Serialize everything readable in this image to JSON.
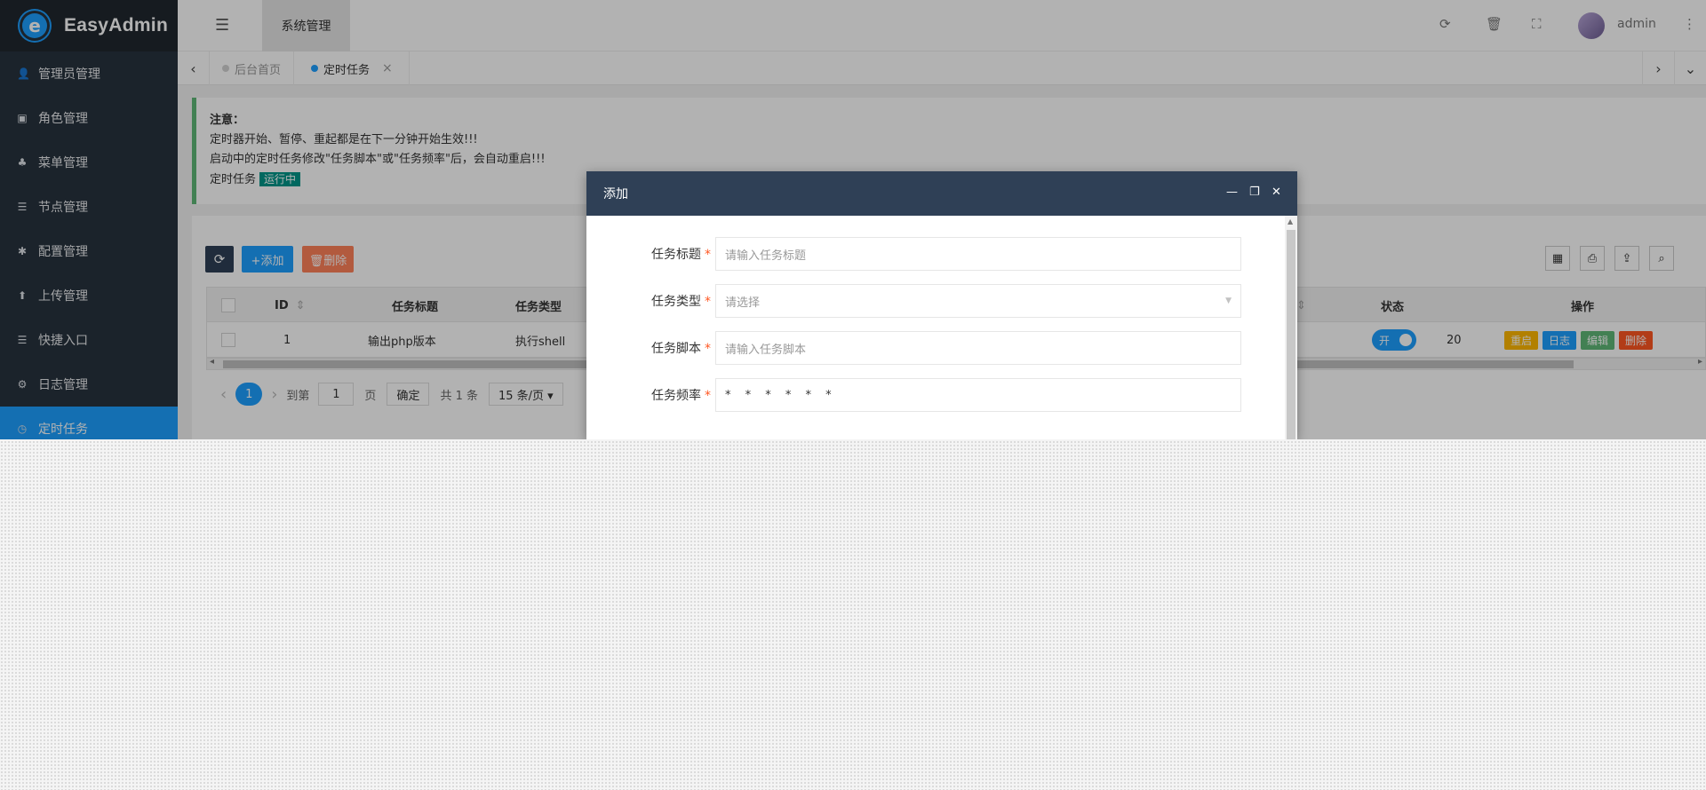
{
  "app": {
    "logo_letter": "e",
    "name": "EasyAdmin"
  },
  "sidebar": {
    "items": [
      {
        "icon": "user-icon",
        "glyph": "👤",
        "label": "管理员管理"
      },
      {
        "icon": "role-icon",
        "glyph": "▣",
        "label": "角色管理"
      },
      {
        "icon": "tree-icon",
        "glyph": "♣",
        "label": "菜单管理"
      },
      {
        "icon": "list-icon",
        "glyph": "☰",
        "label": "节点管理"
      },
      {
        "icon": "asterisk-icon",
        "glyph": "✱",
        "label": "配置管理"
      },
      {
        "icon": "upload-icon",
        "glyph": "⬆",
        "label": "上传管理"
      },
      {
        "icon": "list-icon",
        "glyph": "☰",
        "label": "快捷入口"
      },
      {
        "icon": "gear-icon",
        "glyph": "⚙",
        "label": "日志管理"
      },
      {
        "icon": "clock-icon",
        "glyph": "◷",
        "label": "定时任务"
      }
    ],
    "active_index": 8
  },
  "header": {
    "menu_toggle_glyph": "☰",
    "top_tab": "系统管理",
    "icons": {
      "refresh": "⟳",
      "trash": "🗑",
      "fullscreen": "⛶",
      "more": "⋮"
    },
    "user": "admin"
  },
  "tabs": {
    "prev_glyph": "‹",
    "next_glyph": "›",
    "dropdown_glyph": "⌄",
    "items": [
      {
        "label": "后台首页",
        "dot_color": "#d2d2d2"
      },
      {
        "label": "定时任务",
        "dot_color": "#1e9fff",
        "close": "×"
      }
    ]
  },
  "notice": {
    "title": "注意：",
    "lines": [
      "定时器开始、暂停、重起都是在下一分钟开始生效!!!",
      "启动中的定时任务修改\"任务脚本\"或\"任务频率\"后，会自动重启!!!"
    ],
    "status_label": "定时任务",
    "status_badge": "运行中"
  },
  "toolbar": {
    "refresh_glyph": "⟳",
    "add_label": "+添加",
    "delete_label": "🗑删除",
    "tools": {
      "columns": "▦",
      "print": "⎙",
      "export": "⇪",
      "search": "⌕"
    }
  },
  "table": {
    "headers": {
      "id": "ID",
      "title": "任务标题",
      "type": "任务类型",
      "status": "状态",
      "actions": "操作",
      "sort_glyph": "⇕"
    },
    "rows": [
      {
        "id": "1",
        "title": "输出php版本",
        "type": "执行shell",
        "switch_label": "开",
        "partial": "20",
        "actions": [
          "重启",
          "日志",
          "编辑",
          "删除"
        ]
      }
    ],
    "action_colors": [
      "#ffb800",
      "#1e9fff",
      "#5fb878",
      "#ff5722"
    ],
    "scroll_left": "◂",
    "scroll_right": "▸"
  },
  "pager": {
    "prev": "‹",
    "current": "1",
    "next": "›",
    "goto": "到第",
    "page_input": "1",
    "page_unit": "页",
    "confirm": "确定",
    "total": "共 1 条",
    "per_page": "15 条/页 ▾"
  },
  "modal": {
    "title": "添加",
    "controls": {
      "min": "—",
      "max": "❐",
      "close": "✕"
    },
    "fields": [
      {
        "label": "任务标题",
        "required": "*",
        "placeholder": "请输入任务标题",
        "value": ""
      },
      {
        "label": "任务类型",
        "required": "*",
        "placeholder": "请选择",
        "value": "",
        "arrow": "▼"
      },
      {
        "label": "任务脚本",
        "required": "*",
        "placeholder": "请输入任务脚本",
        "value": ""
      },
      {
        "label": "任务频率",
        "required": "*",
        "placeholder": "",
        "value": "* * * * * *"
      }
    ],
    "scroll_up": "▲"
  }
}
